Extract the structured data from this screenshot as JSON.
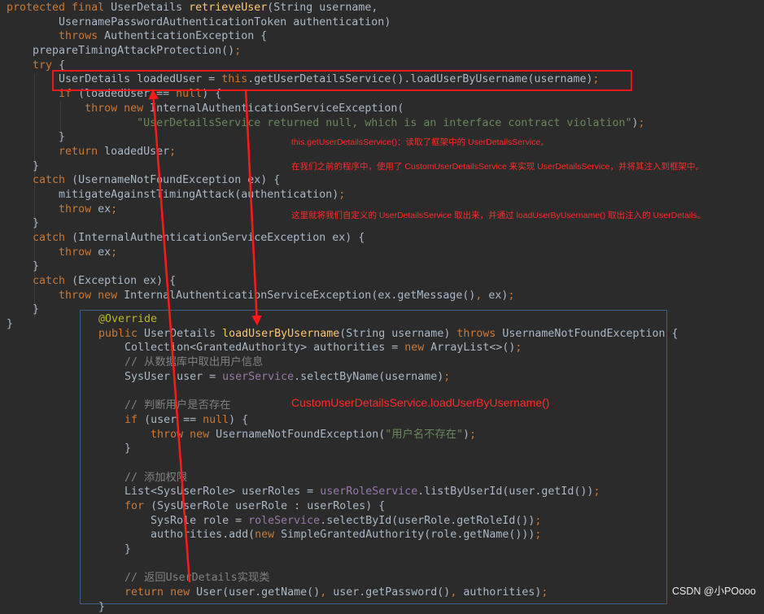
{
  "top_code": [
    [
      [
        "kw",
        "protected final "
      ],
      [
        "t",
        "UserDetails "
      ],
      [
        "fn",
        "retrieveUser"
      ],
      [
        "t",
        "(String username,"
      ]
    ],
    [
      [
        "t",
        "        UsernamePasswordAuthenticationToken authentication)"
      ]
    ],
    [
      [
        "t",
        "        "
      ],
      [
        "kw",
        "throws "
      ],
      [
        "t",
        "AuthenticationException {"
      ]
    ],
    [
      [
        "t",
        "    prepareTimingAttackProtection()"
      ],
      [
        "kw",
        ";"
      ]
    ],
    [
      [
        "t",
        "    "
      ],
      [
        "kw",
        "try "
      ],
      [
        "t",
        "{"
      ]
    ],
    [
      [
        "t",
        "        UserDetails loadedUser = "
      ],
      [
        "kw",
        "this"
      ],
      [
        "t",
        ".getUserDetailsService().loadUserByUsername(username)"
      ],
      [
        "kw",
        ";"
      ]
    ],
    [
      [
        "t",
        "        "
      ],
      [
        "kw",
        "if "
      ],
      [
        "t",
        "(loadedUser == "
      ],
      [
        "kw",
        "null"
      ],
      [
        "t",
        ") {"
      ]
    ],
    [
      [
        "t",
        "            "
      ],
      [
        "kw",
        "throw new "
      ],
      [
        "t",
        "InternalAuthenticationServiceException("
      ]
    ],
    [
      [
        "t",
        "                    "
      ],
      [
        "str",
        "\"UserDetailsService returned null, which is an interface contract violation\""
      ],
      [
        "t",
        ")"
      ],
      [
        "kw",
        ";"
      ]
    ],
    [
      [
        "t",
        "        }"
      ]
    ],
    [
      [
        "t",
        "        "
      ],
      [
        "kw",
        "return "
      ],
      [
        "t",
        "loadedUser"
      ],
      [
        "kw",
        ";"
      ]
    ],
    [
      [
        "t",
        "    }"
      ]
    ],
    [
      [
        "t",
        "    "
      ],
      [
        "kw",
        "catch "
      ],
      [
        "t",
        "(UsernameNotFoundException ex) {"
      ]
    ],
    [
      [
        "t",
        "        mitigateAgainstTimingAttack(authentication)"
      ],
      [
        "kw",
        ";"
      ]
    ],
    [
      [
        "t",
        "        "
      ],
      [
        "kw",
        "throw "
      ],
      [
        "t",
        "ex"
      ],
      [
        "kw",
        ";"
      ]
    ],
    [
      [
        "t",
        "    }"
      ]
    ],
    [
      [
        "t",
        "    "
      ],
      [
        "kw",
        "catch "
      ],
      [
        "t",
        "(InternalAuthenticationServiceException ex) {"
      ]
    ],
    [
      [
        "t",
        "        "
      ],
      [
        "kw",
        "throw "
      ],
      [
        "t",
        "ex"
      ],
      [
        "kw",
        ";"
      ]
    ],
    [
      [
        "t",
        "    }"
      ]
    ],
    [
      [
        "t",
        "    "
      ],
      [
        "kw",
        "catch "
      ],
      [
        "t",
        "(Exception ex) {"
      ]
    ],
    [
      [
        "t",
        "        "
      ],
      [
        "kw",
        "throw new "
      ],
      [
        "t",
        "InternalAuthenticationServiceException(ex.getMessage()"
      ],
      [
        "kw",
        ", "
      ],
      [
        "t",
        "ex)"
      ],
      [
        "kw",
        ";"
      ]
    ],
    [
      [
        "t",
        "    }"
      ]
    ],
    [
      [
        "t",
        "}"
      ]
    ]
  ],
  "bottom_code": [
    [
      [
        "an",
        "@Override"
      ]
    ],
    [
      [
        "kw",
        "public "
      ],
      [
        "t",
        "UserDetails "
      ],
      [
        "fn",
        "loadUserByUsername"
      ],
      [
        "t",
        "(String username) "
      ],
      [
        "kw",
        "throws "
      ],
      [
        "t",
        "UsernameNotFoundException {"
      ]
    ],
    [
      [
        "t",
        "    Collection<GrantedAuthority> authorities = "
      ],
      [
        "kw",
        "new "
      ],
      [
        "t",
        "ArrayList<>()"
      ],
      [
        "kw",
        ";"
      ]
    ],
    [
      [
        "cm",
        "    // 从数据库中取出用户信息"
      ]
    ],
    [
      [
        "t",
        "    SysUser user = "
      ],
      [
        "fld",
        "userService"
      ],
      [
        "t",
        ".selectByName(username)"
      ],
      [
        "kw",
        ";"
      ]
    ],
    [
      [
        "t",
        ""
      ]
    ],
    [
      [
        "cm",
        "    // 判断用户是否存在"
      ]
    ],
    [
      [
        "t",
        "    "
      ],
      [
        "kw",
        "if "
      ],
      [
        "t",
        "(user == "
      ],
      [
        "kw",
        "null"
      ],
      [
        "t",
        ") {"
      ]
    ],
    [
      [
        "t",
        "        "
      ],
      [
        "kw",
        "throw new "
      ],
      [
        "t",
        "UsernameNotFoundException("
      ],
      [
        "str",
        "\"用户名不存在\""
      ],
      [
        "t",
        ")"
      ],
      [
        "kw",
        ";"
      ]
    ],
    [
      [
        "t",
        "    }"
      ]
    ],
    [
      [
        "t",
        ""
      ]
    ],
    [
      [
        "cm",
        "    // 添加权限"
      ]
    ],
    [
      [
        "t",
        "    List<SysUserRole> userRoles = "
      ],
      [
        "fld",
        "userRoleService"
      ],
      [
        "t",
        ".listByUserId(user.getId())"
      ],
      [
        "kw",
        ";"
      ]
    ],
    [
      [
        "t",
        "    "
      ],
      [
        "kw",
        "for "
      ],
      [
        "t",
        "(SysUserRole userRole : userRoles) {"
      ]
    ],
    [
      [
        "t",
        "        SysRole role = "
      ],
      [
        "fld",
        "roleService"
      ],
      [
        "t",
        ".selectById(userRole.getRoleId())"
      ],
      [
        "kw",
        ";"
      ]
    ],
    [
      [
        "t",
        "        authorities.add("
      ],
      [
        "kw",
        "new "
      ],
      [
        "t",
        "SimpleGrantedAuthority(role.getName()))"
      ],
      [
        "kw",
        ";"
      ]
    ],
    [
      [
        "t",
        "    }"
      ]
    ],
    [
      [
        "t",
        ""
      ]
    ],
    [
      [
        "cm",
        "    // 返回UserDetails实现类"
      ]
    ],
    [
      [
        "t",
        "    "
      ],
      [
        "kw",
        "return new "
      ],
      [
        "t",
        "User(user.getName()"
      ],
      [
        "kw",
        ", "
      ],
      [
        "t",
        "user.getPassword()"
      ],
      [
        "kw",
        ", "
      ],
      [
        "t",
        "authorities)"
      ],
      [
        "kw",
        ";"
      ]
    ],
    [
      [
        "t",
        "}"
      ]
    ]
  ],
  "annotations": {
    "note1": "this.getUserDetailsService()：读取了框架中的 UserDetailsService。",
    "note2": "在我们之前的程序中，使用了 CustomUserDetailsService 来实现 UserDetailsService，并将其注入到框架中。",
    "note3": "这里就将我们自定义的 UserDetailsService 取出来，并通过 loadUserByUsername() 取出注入的 UserDetails。",
    "big_label": "CustomUserDetailsService.loadUserByUsername()"
  },
  "watermark": "CSDN @小POooo",
  "colors": {
    "background": "#2b2b2b",
    "text": "#a9b7c6",
    "keyword": "#cc7832",
    "method_decl": "#ffc66d",
    "string": "#6a8759",
    "field": "#9876aa",
    "comment": "#808080",
    "annotation": "#bbb529",
    "annotation_red": "#e8191c"
  }
}
